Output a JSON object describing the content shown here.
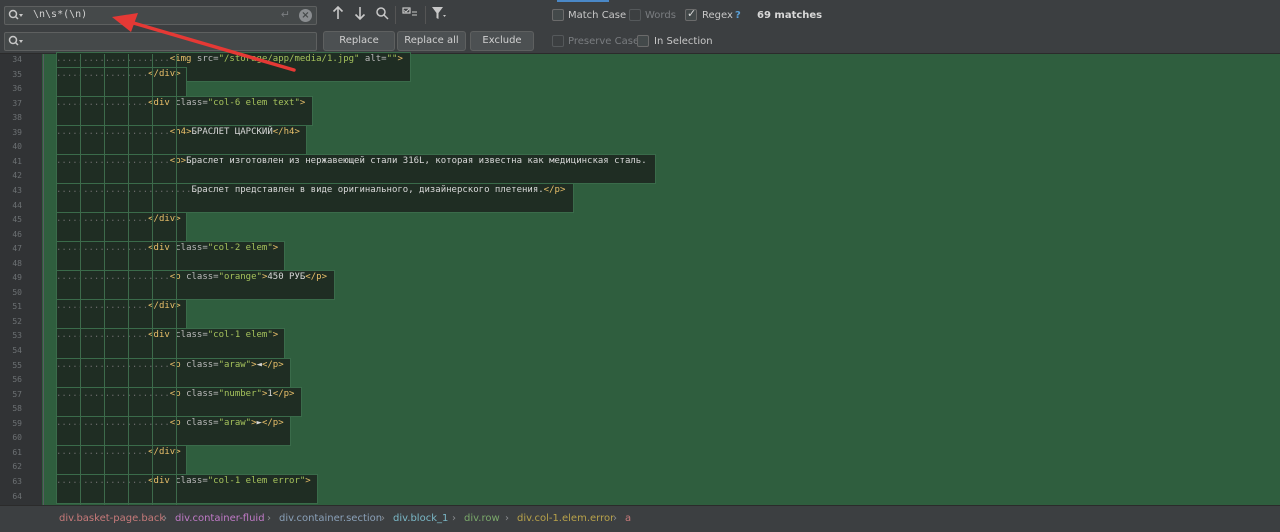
{
  "find": {
    "search_value": "\\n\\s*(\\n)",
    "replace_value": "",
    "replace_label": "Replace",
    "replace_all_label": "Replace all",
    "exclude_label": "Exclude",
    "match_case_label": "Match Case",
    "words_label": "Words",
    "regex_label": "Regex",
    "regex_help": "?",
    "preserve_case_label": "Preserve Case",
    "in_selection_label": "In Selection",
    "matches_label": "69 matches",
    "match_case_checked": false,
    "words_checked": false,
    "regex_checked": true,
    "preserve_case_checked": false,
    "in_selection_checked": false
  },
  "icons": {
    "search_history": "search-history-icon",
    "return": "newline-icon",
    "clear": "clear-icon",
    "prev": "arrow-up-icon",
    "next": "arrow-down-icon",
    "find_all": "find-all-icon",
    "select_all": "select-all-occurrences-icon",
    "filter": "filter-icon"
  },
  "editor": {
    "lines": [
      {
        "n": "34",
        "code": "<img src=\"/storage/app/media/1.jpg\" alt=\"\">"
      },
      {
        "n": "35",
        "code": "</div>"
      },
      {
        "n": "36",
        "code": ""
      },
      {
        "n": "37",
        "code": "<div class=\"col-6 elem text\">"
      },
      {
        "n": "38",
        "code": ""
      },
      {
        "n": "39",
        "code": "<h4>БРАСЛЕТ ЦАРСКИЙ</h4>"
      },
      {
        "n": "40",
        "code": ""
      },
      {
        "n": "41",
        "code": "<p>Браслет изготовлен из нержавеющей стали 316L, которая известна как медицинская сталь."
      },
      {
        "n": "42",
        "code": ""
      },
      {
        "n": "43",
        "code": "Браслет представлен в виде оригинального, дизайнерского плетения.</p>"
      },
      {
        "n": "44",
        "code": ""
      },
      {
        "n": "45",
        "code": "</div>"
      },
      {
        "n": "46",
        "code": ""
      },
      {
        "n": "47",
        "code": "<div class=\"col-2 elem\">"
      },
      {
        "n": "48",
        "code": ""
      },
      {
        "n": "49",
        "code": "<p class=\"orange\">450 РУБ</p>"
      },
      {
        "n": "50",
        "code": ""
      },
      {
        "n": "51",
        "code": "</div>"
      },
      {
        "n": "52",
        "code": ""
      },
      {
        "n": "53",
        "code": "<div class=\"col-1 elem\">"
      },
      {
        "n": "54",
        "code": ""
      },
      {
        "n": "55",
        "code": "<p class=\"araw\">◄</p>"
      },
      {
        "n": "56",
        "code": ""
      },
      {
        "n": "57",
        "code": "<p class=\"number\">1</p>"
      },
      {
        "n": "58",
        "code": ""
      },
      {
        "n": "59",
        "code": "<p class=\"araw\">►</p>"
      },
      {
        "n": "60",
        "code": ""
      },
      {
        "n": "61",
        "code": "</div>"
      },
      {
        "n": "62",
        "code": ""
      },
      {
        "n": "63",
        "code": "<div class=\"col-1 elem error\">"
      },
      {
        "n": "64",
        "code": ""
      }
    ]
  },
  "breadcrumbs": [
    {
      "label": "div.basket-page.back",
      "color": "#c77a7a"
    },
    {
      "label": "div.container-fluid",
      "color": "#c07ac7"
    },
    {
      "label": "div.container.section",
      "color": "#8aa0b8"
    },
    {
      "label": "div.block_1",
      "color": "#7ab8c7"
    },
    {
      "label": "div.row",
      "color": "#7aa86a"
    },
    {
      "label": "div.col-1.elem.error",
      "color": "#b8a24a"
    },
    {
      "label": "a",
      "color": "#c77a7a"
    }
  ],
  "colors": {
    "editor_bg": "#2f5e3e",
    "match_bg": "#1f2d23",
    "tag": "#e8bf6a",
    "string": "#a5c25c",
    "annotation_arrow": "#e53935"
  }
}
